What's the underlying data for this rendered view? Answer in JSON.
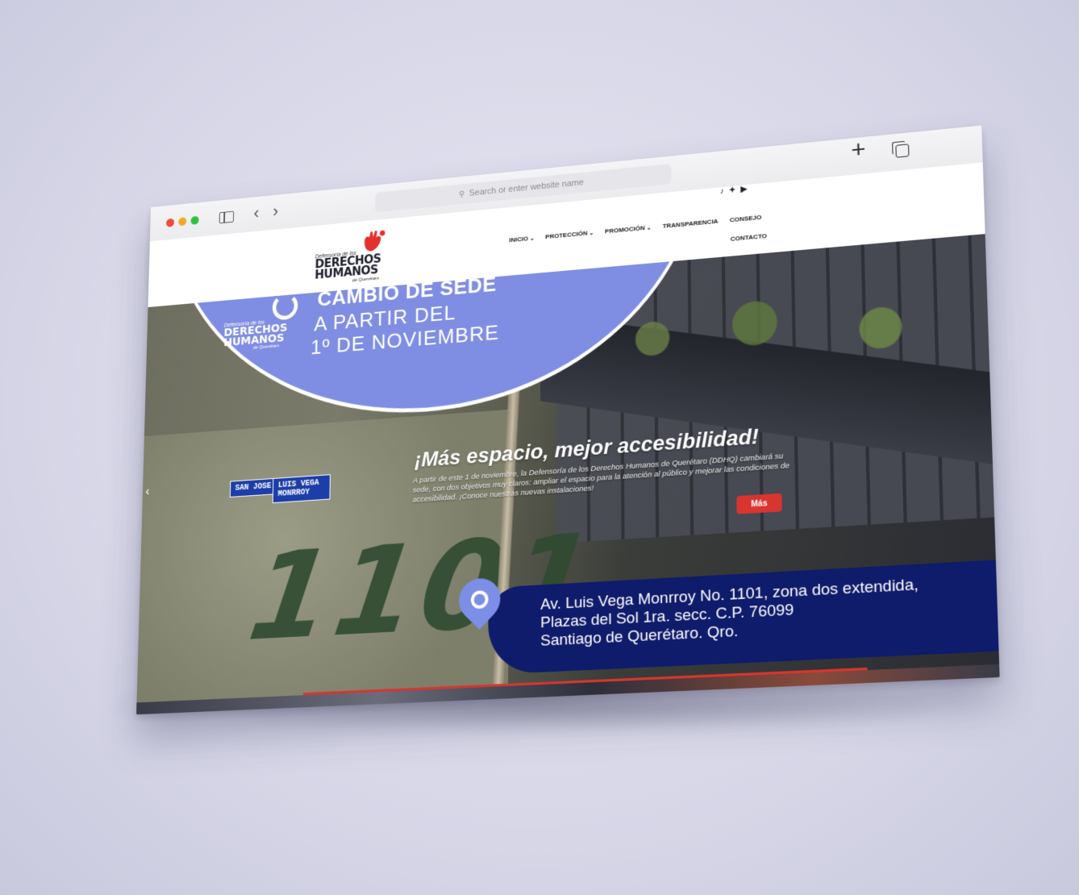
{
  "browser": {
    "url_placeholder": "Search or enter website name"
  },
  "site": {
    "logo": {
      "line_small_top": "Defensoría de los",
      "line_big_1": "DERECHOS",
      "line_big_2": "HUMANOS",
      "line_small_bottom": "de Querétaro"
    },
    "social_icons": [
      "tiktok-icon",
      "twitter-icon",
      "youtube-icon"
    ],
    "nav": [
      {
        "label": "INICIO",
        "has_dropdown": true
      },
      {
        "label": "PROTECCIÓN",
        "has_dropdown": true
      },
      {
        "label": "PROMOCIÓN",
        "has_dropdown": true
      },
      {
        "label": "TRANSPARENCIA",
        "has_dropdown": false
      },
      {
        "label": "CONSEJO",
        "has_dropdown": false
      }
    ],
    "nav_second_row": "CONTACTO",
    "caret": "⌄"
  },
  "hero": {
    "banner_title": "CAMBIO DE SEDE",
    "banner_line1": "A PARTIR DEL",
    "banner_line2": "1º DE NOVIEMBRE",
    "headline": "¡Más espacio, mejor accesibilidad!",
    "description": "A partir de este 1 de noviembre, la Defensoría de los Derechos Humanos de Querétaro (DDHQ) cambiará su sede, con dos objetivos muy claros: ampliar el espacio para la atención al público y mejorar las condiciones de accesibilidad. ¡Conoce nuestras nuevas instalaciones!",
    "button_label": "Más",
    "street_sign_1": "SAN JOSE",
    "street_sign_2": "LUIS VEGA MONRROY",
    "building_number": "1101",
    "address_lines": [
      "Av. Luis Vega Monrroy No. 1101, zona dos extendida,",
      "Plazas del Sol  1ra. secc. C.P. 76099",
      "Santiago de Querétaro. Qro."
    ]
  },
  "colors": {
    "accent_red": "#d83530",
    "banner_blue": "#7f8ee2",
    "address_navy": "#0f1b6b"
  }
}
